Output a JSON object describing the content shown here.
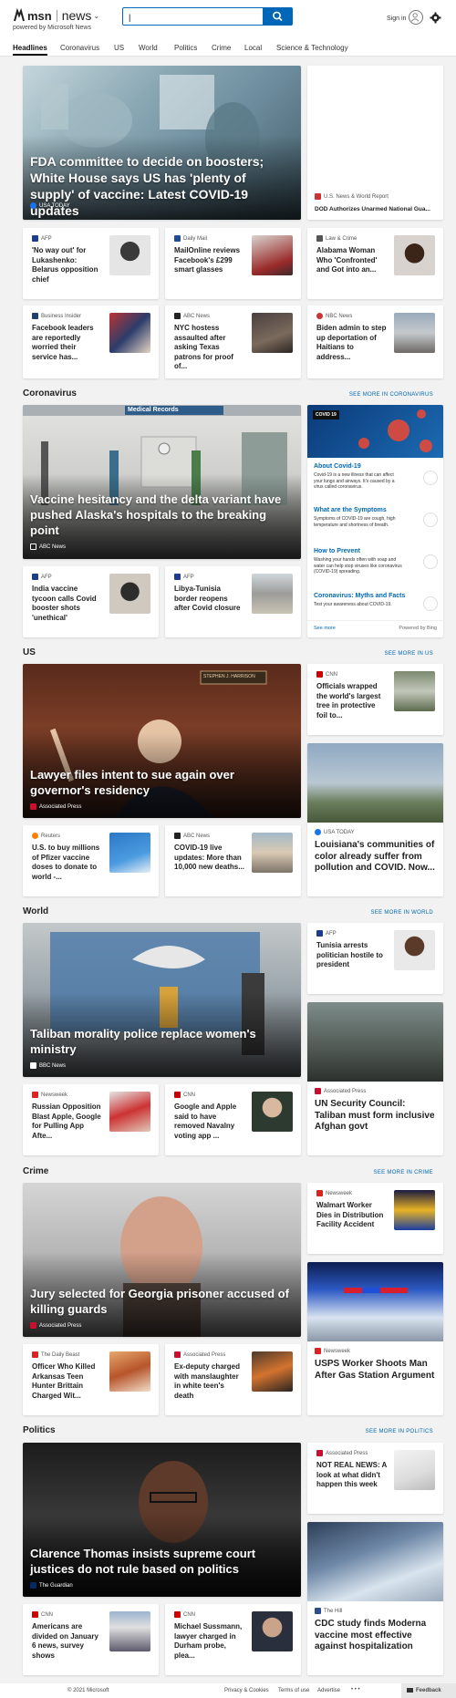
{
  "header": {
    "brand": "msn",
    "section": "news",
    "powered_by": "powered by Microsoft News",
    "search_placeholder": "",
    "sign_in": "Sign in"
  },
  "nav": [
    "Headlines",
    "Coronavirus",
    "US",
    "World",
    "Politics",
    "Crime",
    "Local",
    "Science & Technology"
  ],
  "top": {
    "hero": {
      "title": "FDA committee to decide on boosters; White House says US has 'plenty of supply' of vaccine: Latest COVID-19 updates",
      "source": "USA TODAY"
    },
    "side": {
      "source": "U.S. News & World Report",
      "title": "DOD Authorizes Unarmed National Gua..."
    },
    "row1": [
      {
        "source": "AFP",
        "title": "'No way out' for Lukashenko: Belarus opposition chief"
      },
      {
        "source": "Daily Mail",
        "title": "MailOnline reviews Facebook's £299 smart glasses"
      },
      {
        "source": "Law & Crime",
        "title": "Alabama Woman Who 'Confronted' and Got into an..."
      }
    ],
    "row2": [
      {
        "source": "Business Insider",
        "title": "Facebook leaders are reportedly worried their service has..."
      },
      {
        "source": "ABC News",
        "title": "NYC hostess assaulted after asking Texas patrons for proof of..."
      },
      {
        "source": "NBC News",
        "title": "Biden admin to step up deportation of Haitians to address..."
      }
    ]
  },
  "coronavirus": {
    "heading": "Coronavirus",
    "see_more": "SEE MORE IN CORONAVIRUS",
    "hero": {
      "title": "Vaccine hesitancy and the delta variant have pushed Alaska's hospitals to the breaking point",
      "source": "ABC News",
      "sign": "Medical Records"
    },
    "small": [
      {
        "source": "AFP",
        "title": "India vaccine tycoon calls Covid booster shots 'unethical'"
      },
      {
        "source": "AFP",
        "title": "Libya-Tunisia border reopens after Covid closure"
      }
    ],
    "panel": {
      "badge": "COVID 19",
      "items": [
        {
          "title": "About Covid-19",
          "text": "Covid-19 is a new illness that can affect your lungs and airways. It's caused by a virus called coronavirus."
        },
        {
          "title": "What are the Symptoms",
          "text": "Symptoms of COVID-19 are cough, high temperature and shortness of breath."
        },
        {
          "title": "How to Prevent",
          "text": "Washing your hands often with soap and water can help stop viruses like coronavirus (COVID-19) spreading."
        },
        {
          "title": "Coronavirus: Myths and Facts",
          "text": "Test your awareness about COVID-19."
        }
      ],
      "see_more": "See more",
      "powered": "Powered by Bing"
    }
  },
  "us": {
    "heading": "US",
    "see_more": "SEE MORE IN US",
    "hero": {
      "title": "Lawyer files intent to sue again over governor's residency",
      "source": "Associated Press",
      "nameplate": "STEPHEN J. HARRISON"
    },
    "side_small": {
      "source": "CNN",
      "title": "Officials wrapped the world's largest tree in protective foil to..."
    },
    "side_big": {
      "source": "USA TODAY",
      "title": "Louisiana's communities of color already suffer from pollution and COVID. Now..."
    },
    "small": [
      {
        "source": "Reuters",
        "title": "U.S. to buy millions of Pfizer vaccine doses to donate to world -..."
      },
      {
        "source": "ABC News",
        "title": "COVID-19 live updates: More than 10,000 new deaths..."
      }
    ]
  },
  "world": {
    "heading": "World",
    "see_more": "SEE MORE IN WORLD",
    "hero": {
      "title": "Taliban morality police replace women's ministry",
      "source": "BBC News"
    },
    "side_small": {
      "source": "AFP",
      "title": "Tunisia arrests politician hostile to president"
    },
    "side_big": {
      "source": "Associated Press",
      "title": "UN Security Council: Taliban must form inclusive Afghan govt"
    },
    "small": [
      {
        "source": "Newsweek",
        "title": "Russian Opposition Blast Apple, Google for Pulling App Afte..."
      },
      {
        "source": "CNN",
        "title": "Google and Apple said to have removed Navalny voting app ..."
      }
    ]
  },
  "crime": {
    "heading": "Crime",
    "see_more": "SEE MORE IN CRIME",
    "hero": {
      "title": "Jury selected for Georgia prisoner accused of killing guards",
      "source": "Associated Press"
    },
    "side_small": {
      "source": "Newsweek",
      "title": "Walmart Worker Dies in Distribution Facility Accident"
    },
    "side_big": {
      "source": "Newsweek",
      "title": "USPS Worker Shoots Man After Gas Station Argument"
    },
    "small": [
      {
        "source": "The Daily Beast",
        "title": "Officer Who Killed Arkansas Teen Hunter Brittain Charged Wit..."
      },
      {
        "source": "Associated Press",
        "title": "Ex-deputy charged with manslaughter in white teen's death"
      }
    ]
  },
  "politics": {
    "heading": "Politics",
    "see_more": "SEE MORE IN POLITICS",
    "hero": {
      "title": "Clarence Thomas insists supreme court justices do not rule based on politics",
      "source": "The Guardian"
    },
    "side_small": {
      "source": "Associated Press",
      "title": "NOT REAL NEWS: A look at what didn't happen this week"
    },
    "side_big": {
      "source": "The Hill",
      "title": "CDC study finds Moderna vaccine most effective against hospitalization"
    },
    "small": [
      {
        "source": "CNN",
        "title": "Americans are divided on January 6 news, survey shows"
      },
      {
        "source": "CNN",
        "title": "Michael Sussmann, lawyer charged in Durham probe, plea..."
      }
    ]
  },
  "footer": {
    "copyright": "© 2021 Microsoft",
    "links": [
      "Privacy & Cookies",
      "Terms of use",
      "Advertise"
    ],
    "more": "• • •",
    "feedback": "Feedback"
  }
}
